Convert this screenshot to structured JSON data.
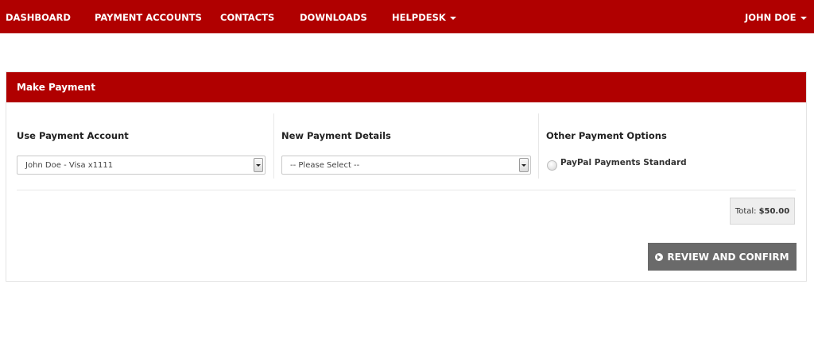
{
  "nav": {
    "dashboard": "DASHBOARD",
    "payment_accounts": "PAYMENT ACCOUNTS",
    "contacts": "CONTACTS",
    "downloads": "DOWNLOADS",
    "helpdesk": "HELPDESK",
    "user": "JOHN DOE"
  },
  "panel": {
    "title": "Make Payment",
    "use_account": {
      "title": "Use Payment Account",
      "selected": "John Doe - Visa x1111"
    },
    "new_details": {
      "title": "New Payment Details",
      "selected": "-- Please Select --"
    },
    "other_options": {
      "title": "Other Payment Options",
      "paypal_label": "PayPal Payments Standard"
    },
    "total": {
      "label": "Total:",
      "value": "$50.00"
    },
    "review_button": "REVIEW AND CONFIRM"
  },
  "colors": {
    "brand_red": "#b00000",
    "button_gray": "#6a6a6a"
  },
  "icons": {
    "helpdesk_caret": "chevron-down-icon",
    "user_caret": "chevron-down-icon",
    "review_button_icon": "circle-arrow-right-icon",
    "select_arrow": "dropdown-arrow-icon"
  }
}
